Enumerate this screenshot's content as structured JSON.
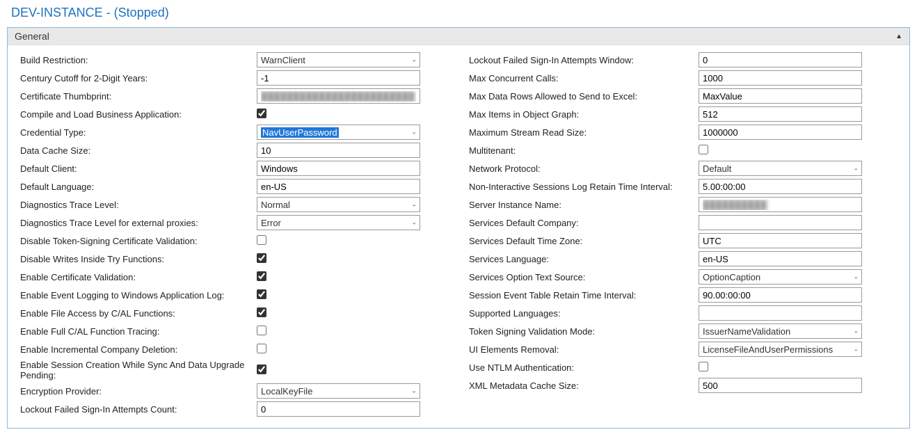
{
  "title": "DEV-INSTANCE - (Stopped)",
  "section": "General",
  "left": {
    "buildRestriction": {
      "label": "Build Restriction:",
      "value": "WarnClient"
    },
    "centuryCutoff": {
      "label": "Century Cutoff for 2-Digit Years:",
      "value": "-1"
    },
    "certThumbprint": {
      "label": "Certificate Thumbprint:",
      "value": "████████████████████████"
    },
    "compileLoad": {
      "label": "Compile and Load Business Application:",
      "checked": true
    },
    "credentialType": {
      "label": "Credential Type:",
      "value": "NavUserPassword"
    },
    "dataCacheSize": {
      "label": "Data Cache Size:",
      "value": "10"
    },
    "defaultClient": {
      "label": "Default Client:",
      "value": "Windows"
    },
    "defaultLanguage": {
      "label": "Default Language:",
      "value": "en-US"
    },
    "diagTraceLevel": {
      "label": "Diagnostics Trace Level:",
      "value": "Normal"
    },
    "diagTraceLevelExt": {
      "label": "Diagnostics Trace Level for external proxies:",
      "value": "Error"
    },
    "disableTokenSigning": {
      "label": "Disable Token-Signing Certificate Validation:",
      "checked": false
    },
    "disableWritesTry": {
      "label": "Disable Writes Inside Try Functions:",
      "checked": true
    },
    "enableCertValidation": {
      "label": "Enable Certificate Validation:",
      "checked": true
    },
    "enableEventLogging": {
      "label": "Enable Event Logging to Windows Application Log:",
      "checked": true
    },
    "enableFileAccess": {
      "label": "Enable File Access by C/AL Functions:",
      "checked": true
    },
    "enableFullTracing": {
      "label": "Enable Full C/AL Function Tracing:",
      "checked": false
    },
    "enableIncremental": {
      "label": "Enable Incremental Company Deletion:",
      "checked": false
    },
    "enableSessionCreation": {
      "label": "Enable Session Creation While Sync And Data Upgrade Pending:",
      "checked": true
    },
    "encryptionProvider": {
      "label": "Encryption Provider:",
      "value": "LocalKeyFile"
    },
    "lockoutCount": {
      "label": "Lockout Failed Sign-In Attempts Count:",
      "value": "0"
    }
  },
  "right": {
    "lockoutWindow": {
      "label": "Lockout Failed Sign-In Attempts Window:",
      "value": "0"
    },
    "maxConcurrent": {
      "label": "Max Concurrent Calls:",
      "value": "1000"
    },
    "maxDataRows": {
      "label": "Max Data Rows Allowed to Send to Excel:",
      "value": "MaxValue"
    },
    "maxItems": {
      "label": "Max Items in Object Graph:",
      "value": "512"
    },
    "maxStream": {
      "label": "Maximum Stream Read Size:",
      "value": "1000000"
    },
    "multitenant": {
      "label": "Multitenant:",
      "checked": false
    },
    "networkProtocol": {
      "label": "Network Protocol:",
      "value": "Default"
    },
    "nonInteractive": {
      "label": "Non-Interactive Sessions Log Retain Time Interval:",
      "value": "5.00:00:00"
    },
    "serverInstance": {
      "label": "Server Instance Name:",
      "value": "██████████"
    },
    "servicesCompany": {
      "label": "Services Default Company:",
      "value": ""
    },
    "servicesTimeZone": {
      "label": "Services Default Time Zone:",
      "value": "UTC"
    },
    "servicesLanguage": {
      "label": "Services Language:",
      "value": "en-US"
    },
    "servicesOptionText": {
      "label": "Services Option Text Source:",
      "value": "OptionCaption"
    },
    "sessionEventRetain": {
      "label": "Session Event Table Retain Time Interval:",
      "value": "90.00:00:00"
    },
    "supportedLanguages": {
      "label": "Supported Languages:",
      "value": ""
    },
    "tokenSigningMode": {
      "label": "Token Signing Validation Mode:",
      "value": "IssuerNameValidation"
    },
    "uiElementsRemoval": {
      "label": "UI Elements Removal:",
      "value": "LicenseFileAndUserPermissions"
    },
    "useNTLM": {
      "label": "Use NTLM Authentication:",
      "checked": false
    },
    "xmlMetadataCache": {
      "label": "XML Metadata Cache Size:",
      "value": "500"
    }
  }
}
